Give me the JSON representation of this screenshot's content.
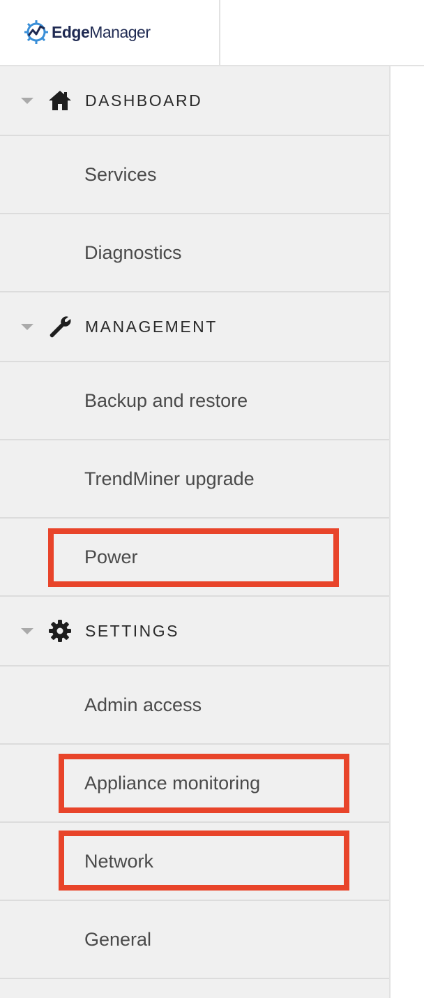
{
  "app": {
    "logo_bold": "Edge",
    "logo_light": "Manager"
  },
  "sidebar": {
    "sections": [
      {
        "label": "DASHBOARD",
        "icon": "home-icon",
        "items": [
          "Services",
          "Diagnostics"
        ]
      },
      {
        "label": "MANAGEMENT",
        "icon": "wrench-icon",
        "items": [
          "Backup and restore",
          "TrendMiner upgrade",
          "Power"
        ]
      },
      {
        "label": "SETTINGS",
        "icon": "gear-icon",
        "items": [
          "Admin access",
          "Appliance monitoring",
          "Network",
          "General"
        ]
      }
    ]
  },
  "colors": {
    "highlight": "#e8442a",
    "sidebar_bg": "#f0f0f0",
    "logo": "#1f2a52",
    "logo_accent": "#3a8fd8"
  }
}
